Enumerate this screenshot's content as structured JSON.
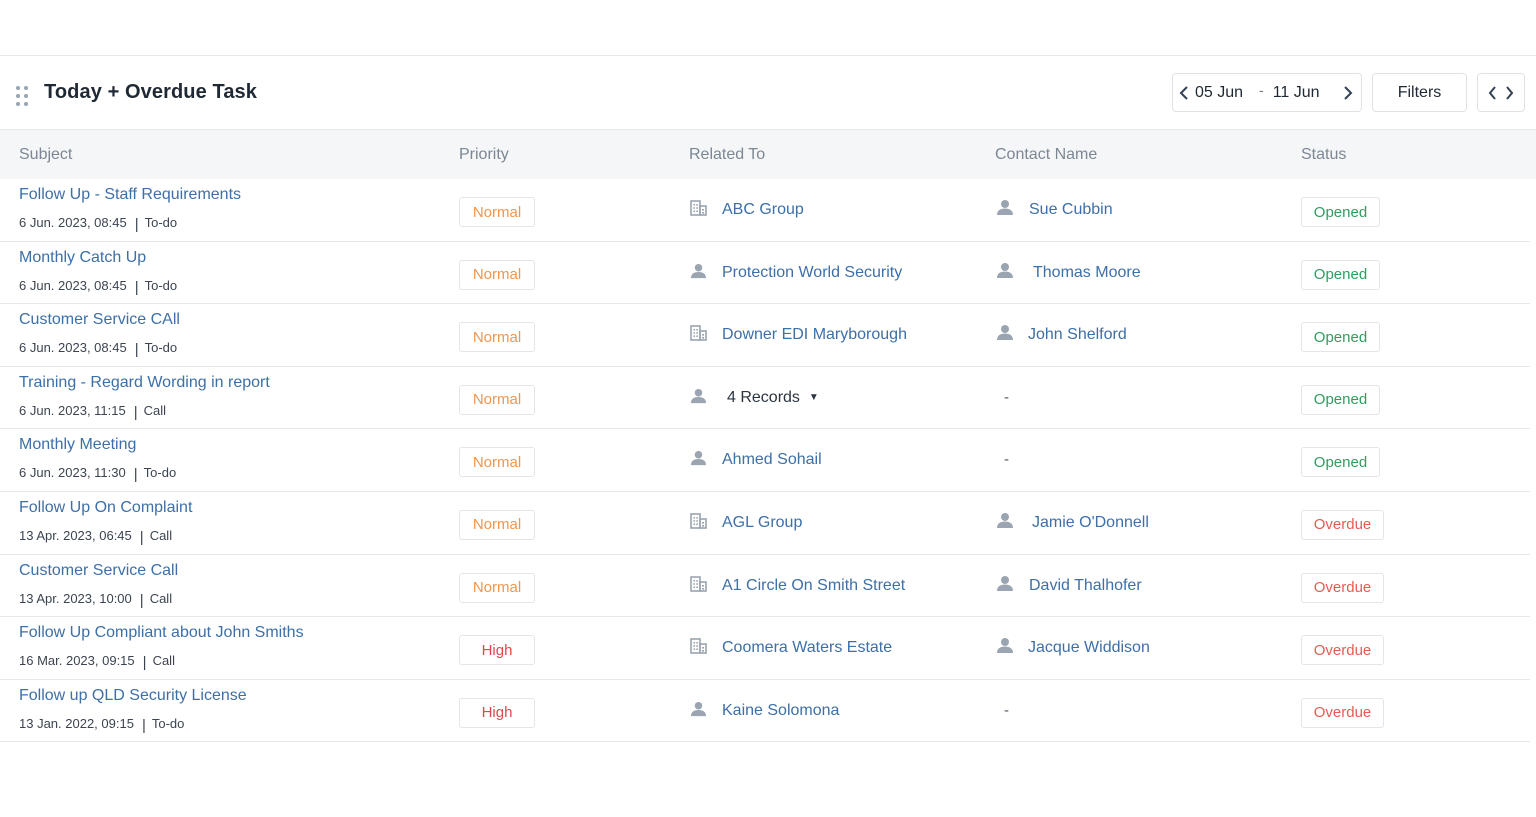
{
  "widget": {
    "title": "Today + Overdue Task",
    "date_start": "05 Jun",
    "date_separator": "-",
    "date_end": "11 Jun",
    "filters_label": "Filters"
  },
  "colors": {
    "priority_normal": "#f0964f",
    "priority_high": "#e0474c",
    "status_opened": "#2e9e5e",
    "status_overdue": "#e35d52",
    "link": "#3d6fa8"
  },
  "columns": {
    "subject": "Subject",
    "priority": "Priority",
    "related_to": "Related To",
    "contact_name": "Contact Name",
    "status": "Status"
  },
  "rows": [
    {
      "subject": "Follow Up - Staff Requirements",
      "date": "6 Jun. 2023, 08:45",
      "type": "To-do",
      "priority": "Normal",
      "related_icon": "building-icon",
      "related": "ABC Group",
      "contact": "Sue Cubbin",
      "status": "Opened"
    },
    {
      "subject": "Monthly Catch Up",
      "date": "6 Jun. 2023, 08:45",
      "type": "To-do",
      "priority": "Normal",
      "related_icon": "person-icon",
      "related": "Protection World Security",
      "contact": "Thomas Moore",
      "status": "Opened"
    },
    {
      "subject": "Customer Service CAll",
      "date": "6 Jun. 2023, 08:45",
      "type": "To-do",
      "priority": "Normal",
      "related_icon": "building-icon",
      "related": "Downer EDI Maryborough",
      "contact": "John Shelford",
      "status": "Opened"
    },
    {
      "subject": "Training - Regard Wording in report",
      "date": "6 Jun. 2023, 11:15",
      "type": "Call",
      "priority": "Normal",
      "related_icon": "person-icon",
      "related": "4 Records",
      "contact": "-",
      "status": "Opened"
    },
    {
      "subject": "Monthly Meeting",
      "date": "6 Jun. 2023, 11:30",
      "type": "To-do",
      "priority": "Normal",
      "related_icon": "person-icon",
      "related": "Ahmed Sohail",
      "contact": "-",
      "status": "Opened"
    },
    {
      "subject": "Follow Up On Complaint",
      "date": "13 Apr. 2023, 06:45",
      "type": "Call",
      "priority": "Normal",
      "related_icon": "building-icon",
      "related": "AGL Group",
      "contact": "Jamie O'Donnell",
      "status": "Overdue"
    },
    {
      "subject": "Customer Service Call",
      "date": "13 Apr. 2023, 10:00",
      "type": "Call",
      "priority": "Normal",
      "related_icon": "building-icon",
      "related": "A1 Circle On Smith Street",
      "contact": "David Thalhofer",
      "status": "Overdue"
    },
    {
      "subject": "Follow Up Compliant about John Smiths",
      "date": "16 Mar. 2023, 09:15",
      "type": "Call",
      "priority": "High",
      "related_icon": "building-icon",
      "related": "Coomera Waters Estate",
      "contact": "Jacque Widdison",
      "status": "Overdue"
    },
    {
      "subject": "Follow up QLD Security License",
      "date": "13 Jan. 2022, 09:15",
      "type": "To-do",
      "priority": "High",
      "related_icon": "person-icon",
      "related": "Kaine Solomona",
      "contact": "-",
      "status": "Overdue"
    }
  ]
}
